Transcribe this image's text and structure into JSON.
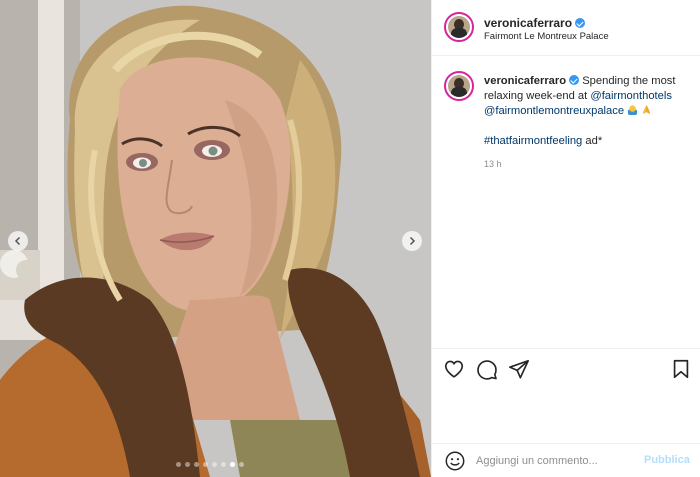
{
  "post": {
    "username": "veronicaferraro",
    "location": "Fairmont Le Montreux Palace",
    "caption_text": "Spending the most relaxing week-end at",
    "mention_1": "@fairmonthotels",
    "mention_2": "@fairmontlemontreuxpalace",
    "hashtag": "#thatfairmontfeeling",
    "ad_label": "ad*",
    "timestamp": "13 h"
  },
  "comment": {
    "placeholder": "Aggiungi un commento...",
    "publish_label": "Pubblica"
  },
  "carousel": {
    "slide_count": 8,
    "active_index": 6
  },
  "icons": {
    "prev": "chevron-left-icon",
    "next": "chevron-right-icon",
    "like": "heart-icon",
    "comment": "comment-bubble-icon",
    "share": "paper-plane-icon",
    "save": "bookmark-icon",
    "emoji": "smiley-icon",
    "verified": "verified-badge-icon"
  },
  "colors": {
    "link": "#00376b",
    "verified": "#3897f0",
    "publish_disabled": "#b2dffc",
    "muted": "#8e8e8e"
  }
}
